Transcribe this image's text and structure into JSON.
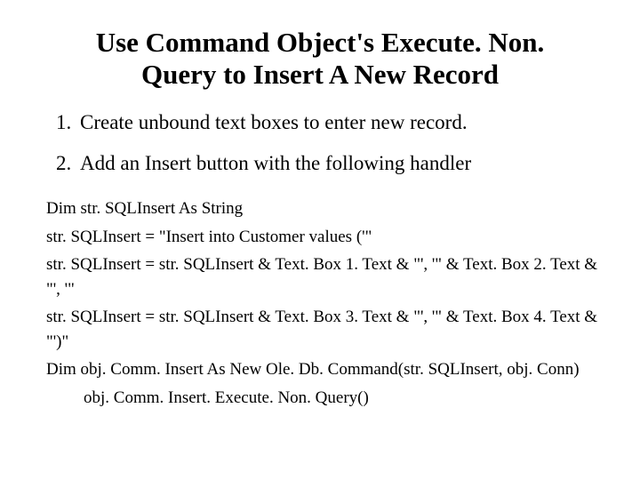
{
  "title": "Use Command Object's Execute. Non. Query to Insert A New Record",
  "steps": [
    "Create unbound text boxes to enter new record.",
    "Add an Insert button with the following handler"
  ],
  "code": {
    "line1": "Dim str. SQLInsert As String",
    "line2": "str. SQLInsert = \"Insert into Customer values ('\"",
    "line3": "str. SQLInsert = str. SQLInsert & Text. Box 1. Text & \"', '\" & Text. Box 2. Text & \"', '\"",
    "line4": "str. SQLInsert = str. SQLInsert & Text. Box 3. Text & \"', '\" & Text. Box 4. Text & \"')\"",
    "line5": "Dim obj. Comm. Insert As New Ole. Db. Command(str. SQLInsert, obj. Conn)",
    "line6": "obj. Comm. Insert. Execute. Non. Query()"
  }
}
